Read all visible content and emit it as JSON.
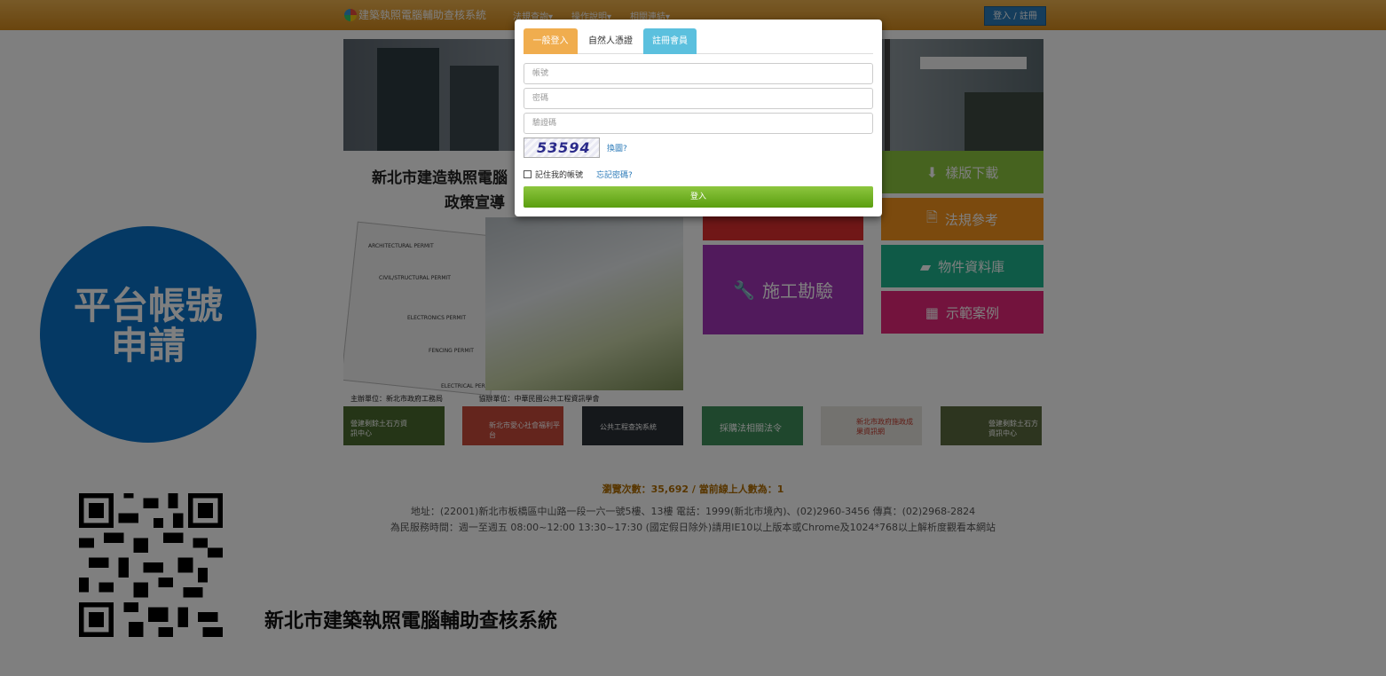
{
  "navbar": {
    "brand": "建築執照電腦輔助查核系統",
    "menu": [
      "法規查詢▾",
      "操作說明▾",
      "相關連結▾"
    ],
    "login_button": "登入 / 註冊"
  },
  "poster": {
    "title": "新北市建造執照電腦",
    "subtitle": "政策宣導",
    "permits": [
      "ARCHITECTURAL PERMIT",
      "CIVIL/STRUCTURAL PERMIT",
      "ELECTRONICS PERMIT",
      "FENCING PERMIT",
      "ELECTRICAL PERMIT"
    ],
    "organizer": "主辦單位：新北市政府工務局",
    "co_organizer": "協辦單位：中華民國公共工程資訊學會"
  },
  "tiles": {
    "download": "樣版下載",
    "regulations": "法規參考",
    "inspection": "施工勘驗",
    "object_db": "物件資料庫",
    "examples": "示範案例"
  },
  "thumbnails": [
    {
      "text": "營建剩餘土石方資訊中心",
      "color": "#4a6b2f"
    },
    {
      "text": "新北市愛心社會福利平台",
      "color": "#c84a3a"
    },
    {
      "text": "公共工程查詢系統",
      "color": "#2a3036"
    },
    {
      "text": "採購法相關法令",
      "color": "#3e8e5a"
    },
    {
      "text": "新北市政府施政成果資訊網",
      "color": "#e7e4df"
    },
    {
      "text": "營建剩餘土石方資訊中心",
      "color": "#5a6b3e"
    }
  ],
  "footer": {
    "visits": "瀏覽次數：35,692 / 當前線上人數為：1",
    "address": "地址：(22001)新北市板橋區中山路一段一六一號5樓、13樓 電話：1999(新北市境內)、(02)2960-3456 傳真：(02)2968-2824",
    "hours": "為民服務時間：週一至週五 08:00~12:00 13:30~17:30 (國定假日除外)請用IE10以上版本或Chrome及1024*768以上解析度觀看本網站"
  },
  "left_panel": {
    "apply_line1": "平台帳號",
    "apply_line2": "申請",
    "system_title": "新北市建築執照電腦輔助查核系統"
  },
  "login_modal": {
    "tabs": [
      "一般登入",
      "自然人憑證",
      "註冊會員"
    ],
    "account_placeholder": "帳號",
    "password_placeholder": "密碼",
    "captcha_placeholder": "驗證碼",
    "captcha_code": "53594",
    "refresh_link": "換圖?",
    "remember_label": "記住我的帳號",
    "forgot_link": "忘記密碼?",
    "submit_label": "登入"
  },
  "colors": {
    "navbar": "#e09a2c",
    "tile_green": "#8cc63f",
    "tile_orange": "#f7941d",
    "tile_teal": "#1fb58f",
    "tile_purple": "#a334b8",
    "tile_pink": "#e6277a",
    "tile_red": "#e02f2f",
    "circle_blue": "#0a72c8",
    "tab_orange": "#f0ad4e",
    "tab_blue": "#5bc0de"
  }
}
